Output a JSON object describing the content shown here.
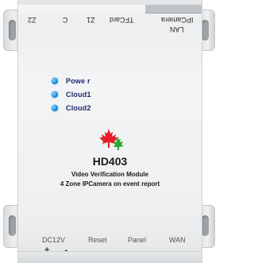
{
  "top_connectors": {
    "z2": "Z2",
    "c": "C",
    "z1": "Z1",
    "tfcard": "TFCard",
    "ipcamera": "IPCamera",
    "lan": "LAN"
  },
  "leds": [
    {
      "label": "Powe r",
      "color": "#1b8de0"
    },
    {
      "label": "Cloud1",
      "color": "#1b8de0"
    },
    {
      "label": "Cloud2",
      "color": "#1b8de0"
    }
  ],
  "logo": {
    "icon": "maple-leaf-icon",
    "colors": [
      "#e41e26",
      "#2aa836"
    ]
  },
  "product": {
    "model": "HD403",
    "line1": "Video Verification Module",
    "line2": "4 Zone IPCamera on event report"
  },
  "bottom_ports": {
    "dc": "DC12V",
    "polarity": "+ -",
    "reset": "Reset",
    "panel": "Panel",
    "wan": "WAN"
  }
}
